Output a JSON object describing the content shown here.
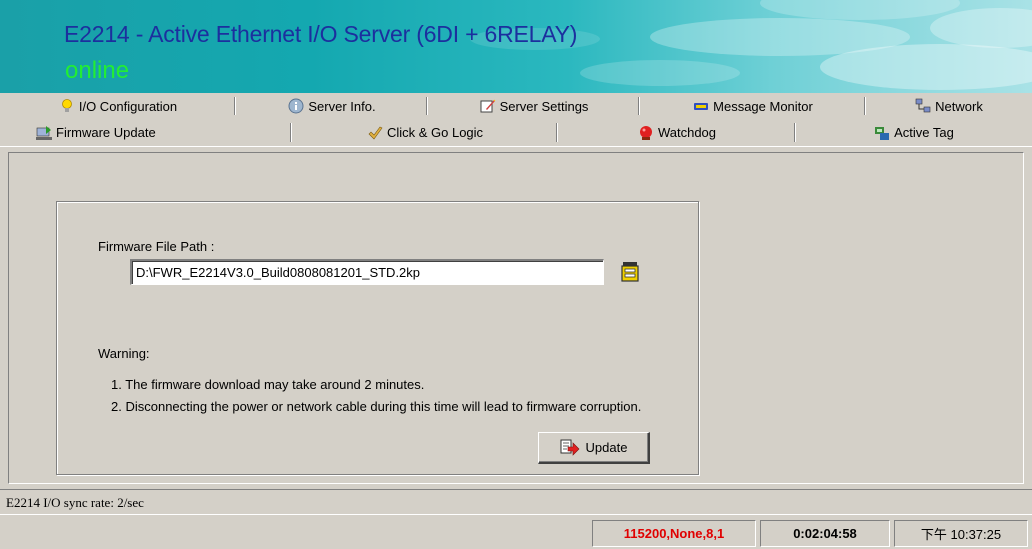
{
  "header": {
    "title": "E2214 - Active Ethernet I/O Server (6DI + 6RELAY)",
    "status": "online"
  },
  "tabs_row1": [
    {
      "label": "I/O Configuration",
      "icon": "lightbulb-icon"
    },
    {
      "label": "Server Info.",
      "icon": "info-icon"
    },
    {
      "label": "Server Settings",
      "icon": "settings-pen-icon"
    },
    {
      "label": "Message Monitor",
      "icon": "message-monitor-icon"
    },
    {
      "label": "Network",
      "icon": "network-icon"
    }
  ],
  "tabs_row2": [
    {
      "label": "Firmware Update",
      "icon": "firmware-update-icon",
      "active": true
    },
    {
      "label": "Click & Go Logic",
      "icon": "hand-logic-icon"
    },
    {
      "label": "Watchdog",
      "icon": "watchdog-icon"
    },
    {
      "label": "Active Tag",
      "icon": "active-tag-icon"
    }
  ],
  "firmware": {
    "path_label": "Firmware File Path :",
    "path_value": "D:\\FWR_E2214V3.0_Build0808081201_STD.2kp",
    "warning_title": "Warning:",
    "warnings": [
      "1. The firmware download may take around 2 minutes.",
      "2. Disconnecting the power or network cable during this time will lead to firmware corruption."
    ],
    "update_label": "Update"
  },
  "sync_rate": "E2214 I/O sync rate: 2/sec",
  "status": {
    "port": "115200,None,8,1",
    "elapsed": "0:02:04:58",
    "clock": "下午 10:37:25"
  },
  "colors": {
    "title": "#1c2f9e",
    "online": "#22ee33",
    "port": "#e00000",
    "face": "#d4d0c8"
  }
}
